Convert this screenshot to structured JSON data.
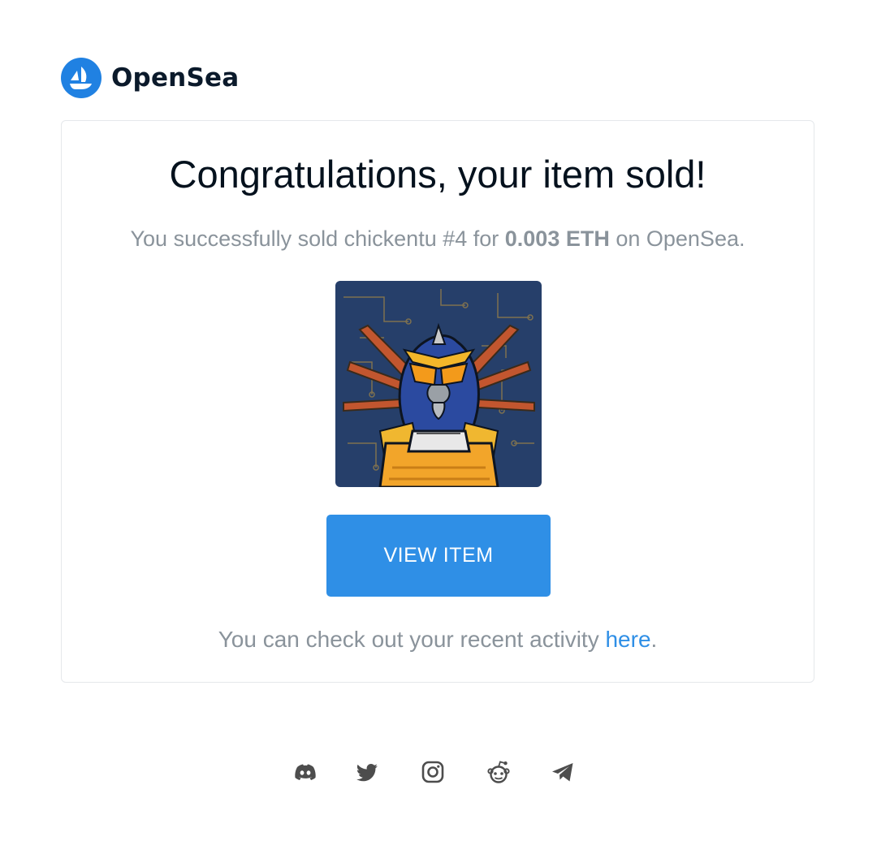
{
  "header": {
    "brand": "OpenSea",
    "logo_icon": "opensea-logo-icon"
  },
  "card": {
    "title": "Congratulations, your item sold!",
    "message_prefix": "You successfully sold chickentu #4 for ",
    "price": "0.003 ETH",
    "message_suffix": " on OpenSea.",
    "item_image": "nft-image",
    "button_label": "VIEW ITEM",
    "activity_prefix": "You can check out your recent activity ",
    "activity_link": "here",
    "activity_suffix": "."
  },
  "footer": {
    "social": [
      "discord-icon",
      "twitter-icon",
      "instagram-icon",
      "reddit-icon",
      "telegram-icon"
    ]
  },
  "colors": {
    "brand_blue": "#2081e2",
    "button_blue": "#2f8fe6",
    "link_blue": "#2f8fe6",
    "muted_text": "#8a939b",
    "title_text": "#04111d",
    "border": "#e5e8eb",
    "social_icon": "#4d4d4d"
  }
}
